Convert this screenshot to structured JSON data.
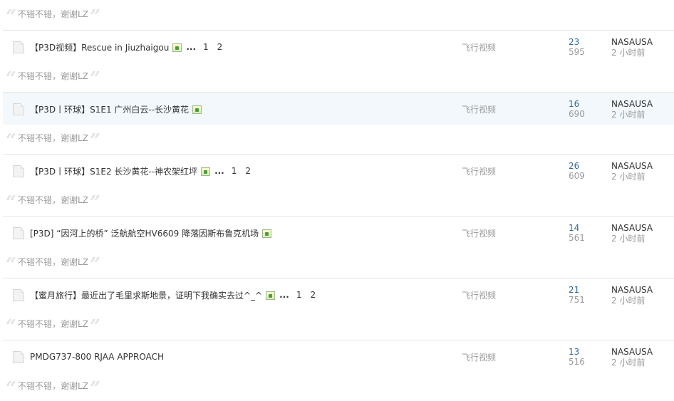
{
  "quote_text": "不错不错，谢谢LZ",
  "threads": [
    {
      "title": "【P3D视频】Rescue in Jiuzhaigou",
      "has_image": true,
      "pages": [
        "1",
        "2"
      ],
      "forum": "飞行视频",
      "replies": "23",
      "views": "595",
      "last_author": "NASAUSA",
      "last_time": "2 小时前",
      "highlighted": false
    },
    {
      "title": "【P3D丨环球】S1E1 广州白云--长沙黄花",
      "has_image": true,
      "pages": [],
      "forum": "飞行视频",
      "replies": "16",
      "views": "690",
      "last_author": "NASAUSA",
      "last_time": "2 小时前",
      "highlighted": true
    },
    {
      "title": "【P3D丨环球】S1E2 长沙黄花--神农架红坪",
      "has_image": true,
      "pages": [
        "1",
        "2"
      ],
      "forum": "飞行视频",
      "replies": "26",
      "views": "609",
      "last_author": "NASAUSA",
      "last_time": "2 小时前",
      "highlighted": false
    },
    {
      "title": "[P3D] “因河上的桥”  泛航航空HV6609 降落因斯布鲁克机场",
      "has_image": true,
      "pages": [],
      "forum": "飞行视频",
      "replies": "14",
      "views": "561",
      "last_author": "NASAUSA",
      "last_time": "2 小时前",
      "highlighted": false
    },
    {
      "title": "【蜜月旅行】最近出了毛里求斯地景，证明下我确实去过^_^",
      "has_image": true,
      "pages": [
        "1",
        "2"
      ],
      "forum": "飞行视频",
      "replies": "21",
      "views": "751",
      "last_author": "NASAUSA",
      "last_time": "2 小时前",
      "highlighted": false
    },
    {
      "title": "PMDG737-800 RJAA APPROACH",
      "has_image": false,
      "pages": [],
      "forum": "飞行视频",
      "replies": "13",
      "views": "516",
      "last_author": "NASAUSA",
      "last_time": "2 小时前",
      "highlighted": false
    }
  ],
  "ellipsis": "...",
  "icons": {
    "doc": "thread-doc-icon",
    "image": "image-attachment-icon",
    "quote": "quote-mark-icon"
  },
  "colors": {
    "highlight_row": "#f2f8fc",
    "reply_count": "#336699",
    "muted_text": "#999999"
  }
}
